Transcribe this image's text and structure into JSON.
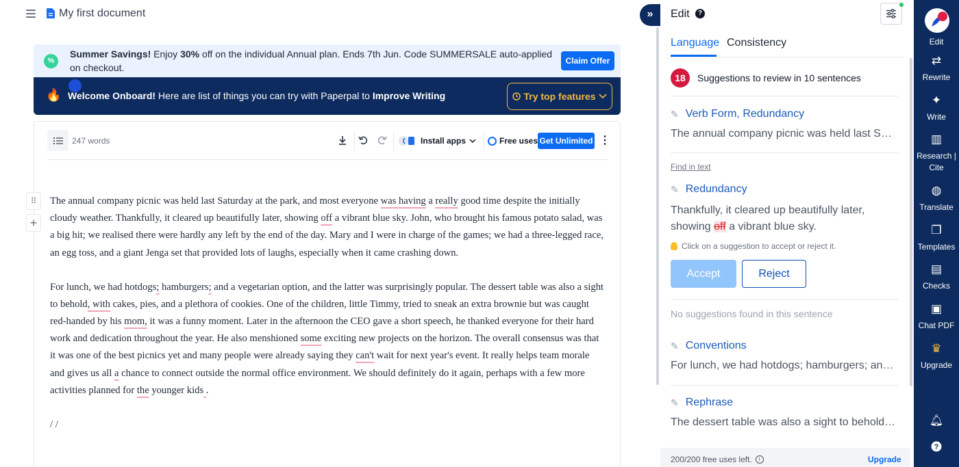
{
  "header": {
    "doc_title": "My first document"
  },
  "promo": {
    "text_bold": "Summer Savings!",
    "text_1": " Enjoy ",
    "text_pct": "30%",
    "text_2": " off on the individual Annual plan. Ends 7th Jun. Code SUMMERSALE auto-applied on checkout.",
    "claim_label": "Claim Offer"
  },
  "onboard": {
    "welcome_bold": "Welcome Onboard!",
    "text": " Here are list of things you can try with Paperpal to ",
    "improve_bold": "Improve Writing",
    "try_label": "Try top features"
  },
  "toolbar": {
    "word_count": "247 words",
    "install_label": "Install apps",
    "free_uses_label": "Free uses",
    "unlimited_label": "Get Unlimited"
  },
  "document": {
    "p1": {
      "a": "The annual company picnic was held last Saturday at the park, and most everyone ",
      "u1": "was having",
      "b": " a ",
      "u2": "really",
      "c": " good time despite the initially cloudy weather. Thankfully, it cleared up beautifully later, showing ",
      "u3": "off",
      "d": " a vibrant blue sky. John, who brought his famous potato salad, was a big hit; we realised there were hardly any left by the end of the day. Mary and I were in charge of the games; we had a three-legged race, an egg toss, and a giant Jenga set that provided lots of laughs, especially when it came crashing down."
    },
    "p2": {
      "a": "For lunch, we had hotdogs",
      "u1": ";",
      "b": " hamburgers",
      "u2": ";",
      "c": " and a vegetarian option, and the latter was surprisingly popular. The dessert table was also a sight to behold",
      "u3": ", with",
      "d": " cakes, pies, and a plethora of cookies. One of the children, little Timmy, tried to sneak an extra brownie but was caught red-handed by his ",
      "u4": "mom,",
      "e": " it was a funny moment.  Later in the afternoon the CEO gave a short speech, he thanked everyone for their hard work and dedication throughout the year. He also menshioned ",
      "u5": "some",
      "f": " exciting new projects on the horizon. The overall consensus was that it was one of the best picnics yet and many people were already saying they ",
      "u6": "can't",
      "g": " wait for next year's event. It really helps team morale and gives us all ",
      "u7": "a",
      "h": " chance to connect outside the normal office environment. We should definitely do it again, perhaps with a few more activities planned for ",
      "u8": "the",
      "i": " younger kids",
      "u9": " ",
      "j": "."
    },
    "p3": "/ /"
  },
  "panel": {
    "title": "Edit",
    "help": "?",
    "tabs": [
      "Language",
      "Consistency"
    ],
    "count": "18",
    "count_text": "Suggestions to review in 10 sentences",
    "suggestions": [
      {
        "category": "Verb Form, Redundancy",
        "preview": "The annual company picnic was held last Saturday at the park, and most everyone"
      },
      {
        "category": "Redundancy"
      },
      {
        "category": "Conventions",
        "preview": "For lunch, we had hotdogs; hamburgers; and a vegetarian option"
      },
      {
        "category": "Rephrase",
        "preview": "The dessert table was also a sight to behold, with cakes, pies"
      }
    ],
    "find_in_text": "Find in text",
    "active_sentence_a": "Thankfully, it cleared up beautifully later, showing ",
    "active_sentence_strike": "off",
    "active_sentence_b": " a vibrant blue sky.",
    "hint": "Click on a suggestion to accept or reject it.",
    "accept_label": "Accept",
    "reject_label": "Reject",
    "no_suggestions": "No suggestions found in this sentence",
    "footer_text": "200/200 free uses left.",
    "footer_upgrade": "Upgrade"
  },
  "rightnav": {
    "items": [
      "Edit",
      "Rewrite",
      "Write",
      "Research | Cite",
      "Translate",
      "Templates",
      "Checks",
      "Chat PDF",
      "Upgrade"
    ]
  },
  "colors": {
    "brand_blue": "#0b6bf2",
    "navy": "#0d2b5e",
    "badge_red": "#d6193f",
    "underline_pink": "#f0a3b6"
  }
}
